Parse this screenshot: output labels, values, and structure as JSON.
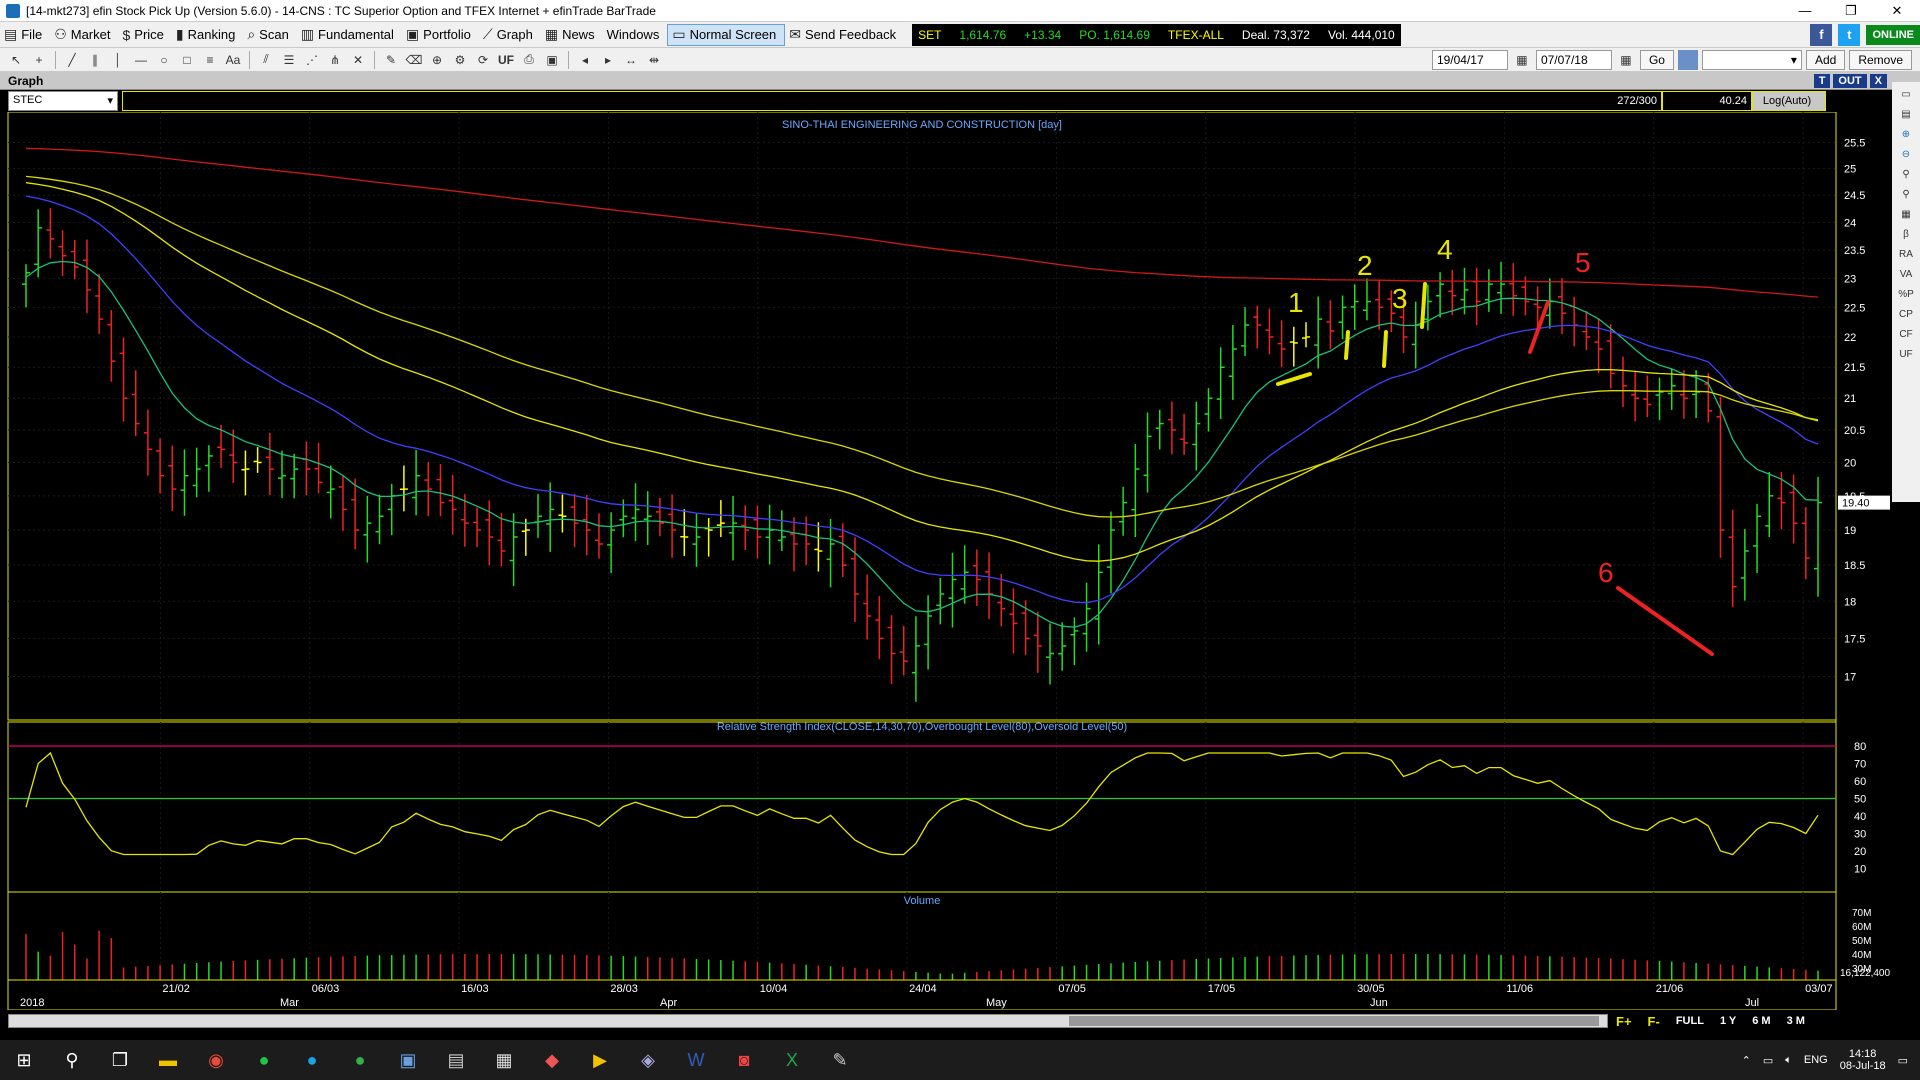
{
  "window": {
    "title": "[14-mkt273] efin Stock Pick Up (Version 5.6.0) - 14-CNS : TC Superior Option and TFEX Internet + efinTrade BarTrade"
  },
  "menu": [
    {
      "label": "File",
      "icon": "file-icon"
    },
    {
      "label": "Market",
      "icon": "market-icon"
    },
    {
      "label": "Price",
      "icon": "dollar-icon"
    },
    {
      "label": "Ranking",
      "icon": "ranking-icon"
    },
    {
      "label": "Scan",
      "icon": "scan-icon"
    },
    {
      "label": "Fundamental",
      "icon": "fundamental-icon"
    },
    {
      "label": "Portfolio",
      "icon": "portfolio-icon"
    },
    {
      "label": "Graph",
      "icon": "graph-icon"
    },
    {
      "label": "News",
      "icon": "news-icon"
    },
    {
      "label": "Windows",
      "icon": ""
    },
    {
      "label": "Normal Screen",
      "icon": "screen-icon"
    },
    {
      "label": "Send Feedback",
      "icon": "feedback-icon"
    }
  ],
  "ticker": {
    "set": "SET",
    "index": "1,614.76",
    "change": "+13.34",
    "po": "PO. 1,614.69",
    "tfex": "TFEX-ALL",
    "deal": "Deal. 73,372",
    "vol": "Vol. 444,010"
  },
  "status": {
    "online": "ONLINE"
  },
  "toolbar": {
    "uf": "UF",
    "date_from": "19/04/17",
    "date_to": "07/07/18",
    "go": "Go",
    "add": "Add",
    "remove": "Remove"
  },
  "graph_panel": {
    "title": "Graph",
    "btn_t": "T",
    "btn_out": "OUT",
    "btn_x": "X",
    "symbol": "STEC",
    "count": "272/300",
    "value": "40.24",
    "scale": "Log(Auto)"
  },
  "right_tools": [
    "RA",
    "VA",
    "%P",
    "CP",
    "CF",
    "UF"
  ],
  "bottom": {
    "tabs": [
      "FULL",
      "1 Y",
      "6 M",
      "3 M"
    ]
  },
  "taskbar": {
    "lang": "ENG",
    "time": "14:18",
    "date": "08-Jul-18"
  },
  "colors": {
    "up": "#22dd22",
    "down": "#ee2222",
    "neutral": "#ffff00",
    "ema_green": "#19c27a",
    "ema_blue": "#4040ff",
    "ema_yellow": "#e6e600",
    "ema_red": "#cc1a1a",
    "rsi": "#e6e600"
  },
  "chart_data": {
    "type": "candlestick",
    "title": "SINO-THAI ENGINEERING AND CONSTRUCTION [day]",
    "y_ticks": [
      25.5,
      25,
      24.5,
      24,
      23.5,
      23,
      22.5,
      22,
      21.5,
      21,
      20.5,
      20,
      19.5,
      19,
      18.5,
      18,
      17.5,
      17
    ],
    "last_price": "19.40",
    "x_ticks": [
      "21/02",
      "06/03",
      "16/03",
      "28/03",
      "10/04",
      "24/04",
      "07/05",
      "17/05",
      "30/05",
      "11/06",
      "21/06",
      "03/07"
    ],
    "months": [
      "2018",
      "Mar",
      "Apr",
      "May",
      "Jun",
      "Jul"
    ],
    "close": [
      23.1,
      23.9,
      23.7,
      23.4,
      23.2,
      22.8,
      22.3,
      21.6,
      21.0,
      20.6,
      20.2,
      19.8,
      19.6,
      19.8,
      19.9,
      20.1,
      20.2,
      20.0,
      19.9,
      20.0,
      19.9,
      19.8,
      19.9,
      19.9,
      19.7,
      19.6,
      19.3,
      19.0,
      19.1,
      19.2,
      19.5,
      19.6,
      19.8,
      19.6,
      19.4,
      19.3,
      19.1,
      19.0,
      18.9,
      18.7,
      18.9,
      19.0,
      19.2,
      19.3,
      19.2,
      19.1,
      19.0,
      18.8,
      19.0,
      19.2,
      19.3,
      19.2,
      19.1,
      19.0,
      18.9,
      18.9,
      19.0,
      19.1,
      19.1,
      19.0,
      18.9,
      19.0,
      18.9,
      18.8,
      18.8,
      18.7,
      18.8,
      18.5,
      18.1,
      17.8,
      17.5,
      17.3,
      17.2,
      17.4,
      17.8,
      18.1,
      18.3,
      18.4,
      18.3,
      18.1,
      17.9,
      17.7,
      17.5,
      17.4,
      17.3,
      17.4,
      17.6,
      17.9,
      18.4,
      19.0,
      19.4,
      19.9,
      20.4,
      20.6,
      20.5,
      20.3,
      20.6,
      21.0,
      21.5,
      21.8,
      22.2,
      22.2,
      22.0,
      21.8,
      21.9,
      22.0,
      22.3,
      22.1,
      22.5,
      22.6,
      22.6,
      22.5,
      22.4,
      22.0,
      22.2,
      22.6,
      22.9,
      22.7,
      22.8,
      22.6,
      22.9,
      22.9,
      22.7,
      22.6,
      22.5,
      22.6,
      22.4,
      22.2,
      22.0,
      21.8,
      21.4,
      21.2,
      21.0,
      20.9,
      21.1,
      21.2,
      21.0,
      21.1,
      20.8,
      19.0,
      18.2,
      18.7,
      19.2,
      19.5,
      19.4,
      19.1,
      18.6,
      19.4
    ],
    "rsi": {
      "title": "Relative Strength Index(CLOSE,14,30,70),Overbought Level(80),Oversold Level(50)",
      "ticks": [
        80,
        70,
        60,
        50,
        40,
        30,
        20,
        10
      ],
      "overbought": 80,
      "oversold": 50
    },
    "volume": {
      "title": "Volume",
      "ticks": [
        "70M",
        "60M",
        "50M",
        "40M",
        "30M"
      ],
      "last": "16,122,400"
    },
    "annotations": [
      {
        "label": "1",
        "color": "#e6e600"
      },
      {
        "label": "2",
        "color": "#e6e600"
      },
      {
        "label": "3",
        "color": "#e6e600"
      },
      {
        "label": "4",
        "color": "#e6e600"
      },
      {
        "label": "5",
        "color": "#ee2222"
      },
      {
        "label": "6",
        "color": "#ee2222"
      }
    ]
  }
}
